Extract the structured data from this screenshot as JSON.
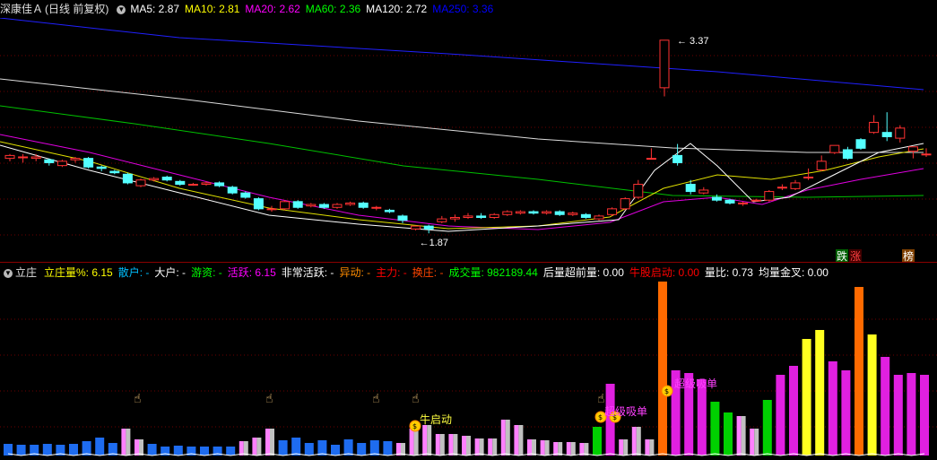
{
  "header": {
    "stock_name": "深康佳Ａ",
    "period": "(日线 前复权)",
    "ma": [
      {
        "label": "MA5:",
        "value": "2.87",
        "color": "#ffffff"
      },
      {
        "label": "MA10:",
        "value": "2.81",
        "color": "#ffff00"
      },
      {
        "label": "MA20:",
        "value": "2.62",
        "color": "#ff00ff"
      },
      {
        "label": "MA60:",
        "value": "2.36",
        "color": "#00ff00"
      },
      {
        "label": "MA120:",
        "value": "2.72",
        "color": "#ffffff"
      },
      {
        "label": "MA250:",
        "value": "3.36",
        "color": "#0000ff"
      }
    ]
  },
  "price_chart": {
    "high_label": "3.37",
    "low_label": "1.87",
    "tag_fall": "跌",
    "tag_rise": "涨",
    "tag_rank": "榜"
  },
  "indicator": {
    "name": "立庄",
    "items": [
      {
        "label": "立庄量%:",
        "value": "6.15",
        "color": "#ffff00"
      },
      {
        "label": "散户:",
        "value": "-",
        "color": "#00bfff"
      },
      {
        "label": "大户:",
        "value": "-",
        "color": "#ffffff"
      },
      {
        "label": "游资:",
        "value": "-",
        "color": "#00ff00"
      },
      {
        "label": "活跃:",
        "value": "6.15",
        "color": "#ff00ff"
      },
      {
        "label": "非常活跃:",
        "value": "-",
        "color": "#ffffff"
      },
      {
        "label": "异动:",
        "value": "-",
        "color": "#ff8c00"
      },
      {
        "label": "主力:",
        "value": "-",
        "color": "#ff0000"
      },
      {
        "label": "换庄:",
        "value": "-",
        "color": "#ff4500"
      },
      {
        "label": "成交量:",
        "value": "982189.44",
        "color": "#00ff00"
      },
      {
        "label": "后量超前量:",
        "value": "0.00",
        "color": "#ffffff"
      },
      {
        "label": "牛股启动:",
        "value": "0.00",
        "color": "#ff0000"
      },
      {
        "label": "量比:",
        "value": "0.73",
        "color": "#ffffff"
      },
      {
        "label": "均量金叉:",
        "value": "0.00",
        "color": "#ffffff"
      }
    ],
    "signals": {
      "bull_start": "牛启动",
      "buy_1": "超级吸单",
      "buy_2": "超级吸单"
    }
  },
  "chart_data": {
    "type": "candlestick",
    "price_range": [
      1.87,
      3.37
    ],
    "candles": [
      [
        2.55,
        2.57,
        2.58,
        2.53
      ],
      [
        2.56,
        2.56,
        2.58,
        2.52
      ],
      [
        2.55,
        2.56,
        2.58,
        2.53
      ],
      [
        2.54,
        2.52,
        2.55,
        2.5
      ],
      [
        2.5,
        2.53,
        2.54,
        2.49
      ],
      [
        2.54,
        2.55,
        2.56,
        2.52
      ],
      [
        2.55,
        2.49,
        2.56,
        2.48
      ],
      [
        2.49,
        2.48,
        2.5,
        2.46
      ],
      [
        2.46,
        2.45,
        2.47,
        2.44
      ],
      [
        2.44,
        2.38,
        2.45,
        2.37
      ],
      [
        2.36,
        2.4,
        2.41,
        2.35
      ],
      [
        2.4,
        2.41,
        2.42,
        2.39
      ],
      [
        2.42,
        2.4,
        2.43,
        2.39
      ],
      [
        2.39,
        2.37,
        2.4,
        2.36
      ],
      [
        2.37,
        2.37,
        2.38,
        2.36
      ],
      [
        2.37,
        2.38,
        2.39,
        2.36
      ],
      [
        2.38,
        2.36,
        2.39,
        2.35
      ],
      [
        2.35,
        2.31,
        2.36,
        2.3
      ],
      [
        2.31,
        2.28,
        2.32,
        2.27
      ],
      [
        2.27,
        2.2,
        2.28,
        2.19
      ],
      [
        2.2,
        2.2,
        2.22,
        2.18
      ],
      [
        2.2,
        2.25,
        2.26,
        2.19
      ],
      [
        2.25,
        2.21,
        2.26,
        2.2
      ],
      [
        2.22,
        2.23,
        2.24,
        2.21
      ],
      [
        2.23,
        2.21,
        2.24,
        2.2
      ],
      [
        2.21,
        2.23,
        2.24,
        2.2
      ],
      [
        2.23,
        2.24,
        2.25,
        2.22
      ],
      [
        2.24,
        2.21,
        2.25,
        2.2
      ],
      [
        2.21,
        2.21,
        2.22,
        2.19
      ],
      [
        2.19,
        2.18,
        2.2,
        2.17
      ],
      [
        2.15,
        2.12,
        2.16,
        2.1
      ],
      [
        2.06,
        2.08,
        2.08,
        2.05
      ],
      [
        2.08,
        2.06,
        2.09,
        2.03
      ],
      [
        2.11,
        2.13,
        2.15,
        2.1
      ],
      [
        2.13,
        2.14,
        2.16,
        2.11
      ],
      [
        2.14,
        2.15,
        2.17,
        2.13
      ],
      [
        2.15,
        2.14,
        2.17,
        2.13
      ],
      [
        2.14,
        2.16,
        2.17,
        2.13
      ],
      [
        2.16,
        2.18,
        2.19,
        2.15
      ],
      [
        2.17,
        2.18,
        2.19,
        2.16
      ],
      [
        2.18,
        2.17,
        2.19,
        2.16
      ],
      [
        2.17,
        2.18,
        2.19,
        2.16
      ],
      [
        2.18,
        2.16,
        2.19,
        2.15
      ],
      [
        2.16,
        2.17,
        2.18,
        2.15
      ],
      [
        2.16,
        2.14,
        2.17,
        2.13
      ],
      [
        2.13,
        2.15,
        2.16,
        2.12
      ],
      [
        2.16,
        2.2,
        2.21,
        2.15
      ],
      [
        2.2,
        2.27,
        2.28,
        2.19
      ],
      [
        2.28,
        2.37,
        2.4,
        2.27
      ],
      [
        2.55,
        2.55,
        2.62,
        2.55
      ],
      [
        3.04,
        3.37,
        3.37,
        2.98
      ],
      [
        2.57,
        2.52,
        2.65,
        2.5
      ],
      [
        2.37,
        2.32,
        2.4,
        2.3
      ],
      [
        2.31,
        2.33,
        2.35,
        2.3
      ],
      [
        2.28,
        2.26,
        2.3,
        2.25
      ],
      [
        2.26,
        2.24,
        2.27,
        2.23
      ],
      [
        2.24,
        2.24,
        2.25,
        2.22
      ],
      [
        2.26,
        2.26,
        2.27,
        2.25
      ],
      [
        2.26,
        2.32,
        2.33,
        2.25
      ],
      [
        2.35,
        2.35,
        2.37,
        2.33
      ],
      [
        2.34,
        2.38,
        2.4,
        2.33
      ],
      [
        2.42,
        2.42,
        2.48,
        2.4
      ],
      [
        2.47,
        2.53,
        2.57,
        2.46
      ],
      [
        2.59,
        2.64,
        2.64,
        2.58
      ],
      [
        2.61,
        2.55,
        2.63,
        2.54
      ],
      [
        2.68,
        2.62,
        2.69,
        2.61
      ],
      [
        2.73,
        2.8,
        2.85,
        2.72
      ],
      [
        2.73,
        2.7,
        2.87,
        2.67
      ],
      [
        2.69,
        2.76,
        2.78,
        2.66
      ],
      [
        2.6,
        2.63,
        2.63,
        2.55
      ],
      [
        2.58,
        2.58,
        2.62,
        2.56
      ]
    ]
  }
}
